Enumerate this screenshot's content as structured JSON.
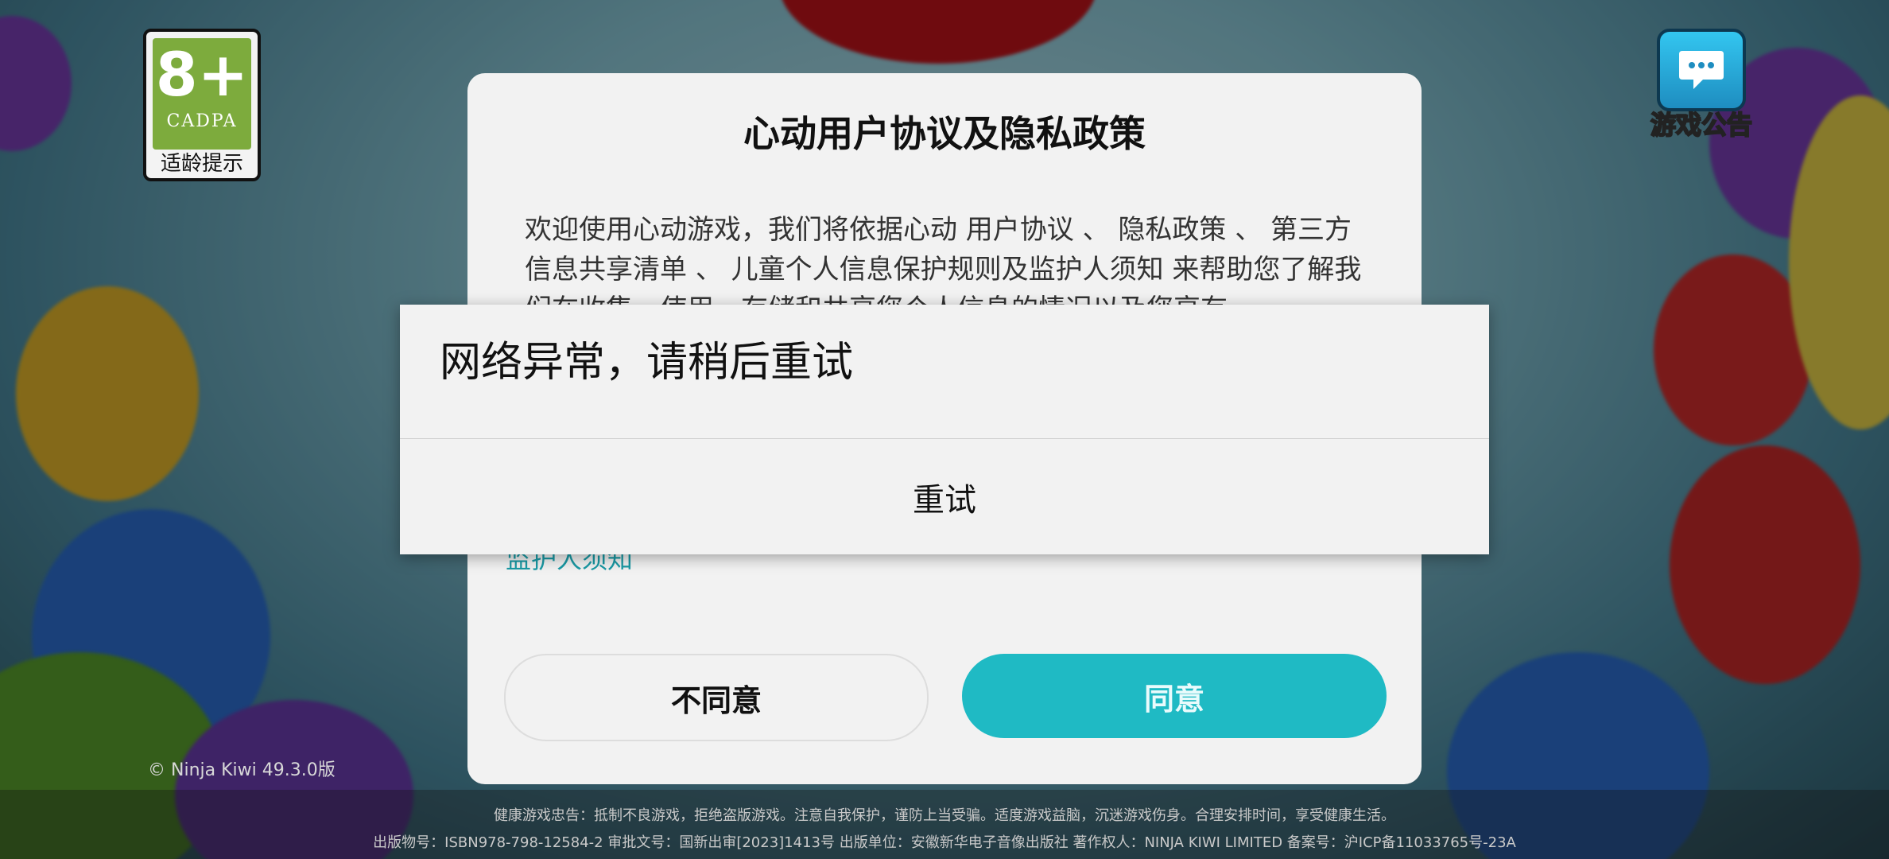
{
  "age_badge": {
    "rating": "8+",
    "org": "CADPA",
    "label": "适龄提示"
  },
  "announcement": {
    "icon": "chat-bubble-icon",
    "label": "游戏公告"
  },
  "agreement_dialog": {
    "title": "心动用户协议及隐私政策",
    "body": "欢迎使用心动游戏，我们将依据心动 用户协议 、 隐私政策 、 第三方信息共享清单 、 儿童个人信息保护规则及监护人须知 来帮助您了解我们在收集、使用、存储和共享您个人信息的情况以及您享有",
    "guardian_link": "监护人须知",
    "disagree_label": "不同意",
    "agree_label": "同意"
  },
  "copyright": "© Ninja Kiwi 49.3.0版",
  "footer": {
    "line1": "健康游戏忠告：抵制不良游戏，拒绝盗版游戏。注意自我保护，谨防上当受骗。适度游戏益脑，沉迷游戏伤身。合理安排时间，享受健康生活。",
    "line2": "出版物号：ISBN978-798-12584-2 审批文号：国新出审[2023]1413号 出版单位：安徽新华电子音像出版社 著作权人：NINJA KIWI LIMITED 备案号：沪ICP备11033765号-23A"
  },
  "error_modal": {
    "message": "网络异常，请稍后重试",
    "retry_label": "重试"
  },
  "colors": {
    "accent": "#1fbac4",
    "badge_green": "#7dab3d",
    "modal_bg": "#f2f2f2"
  }
}
